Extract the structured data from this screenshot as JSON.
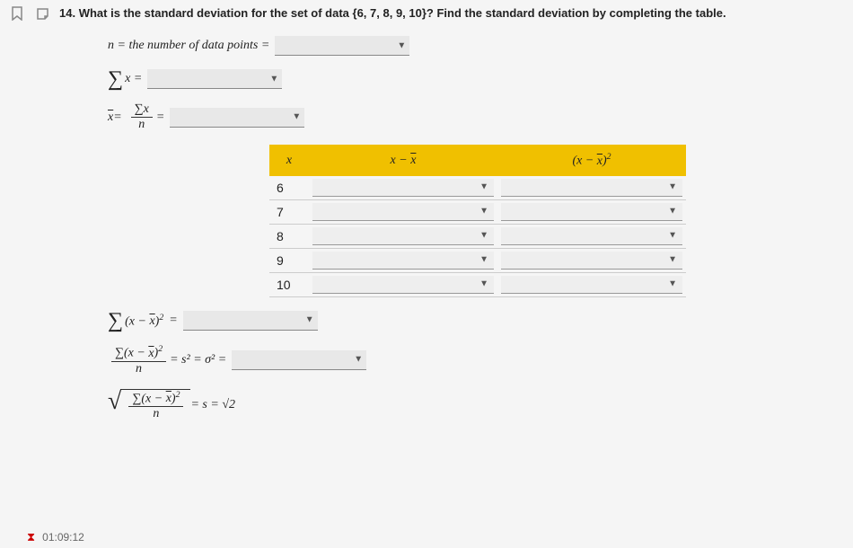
{
  "question": {
    "number": "14.",
    "text": "What is the standard deviation for the set of data  {6, 7, 8, 9, 10}? Find the standard deviation by completing the table."
  },
  "labels": {
    "n_eq": "n = the number of data points =",
    "sum_x_eq": "x =",
    "xbar_eq": " =",
    "sum_sq_eq": " =",
    "variance_eq": " = s² = σ² =",
    "sd_eq": " = s = √2"
  },
  "table": {
    "headers": {
      "x": "x",
      "xmx": "x − x̄",
      "xmx2": "(x − x̄)²"
    },
    "rows": [
      {
        "x": "6"
      },
      {
        "x": "7"
      },
      {
        "x": "8"
      },
      {
        "x": "9"
      },
      {
        "x": "10"
      }
    ]
  },
  "timer": "01:09:12"
}
